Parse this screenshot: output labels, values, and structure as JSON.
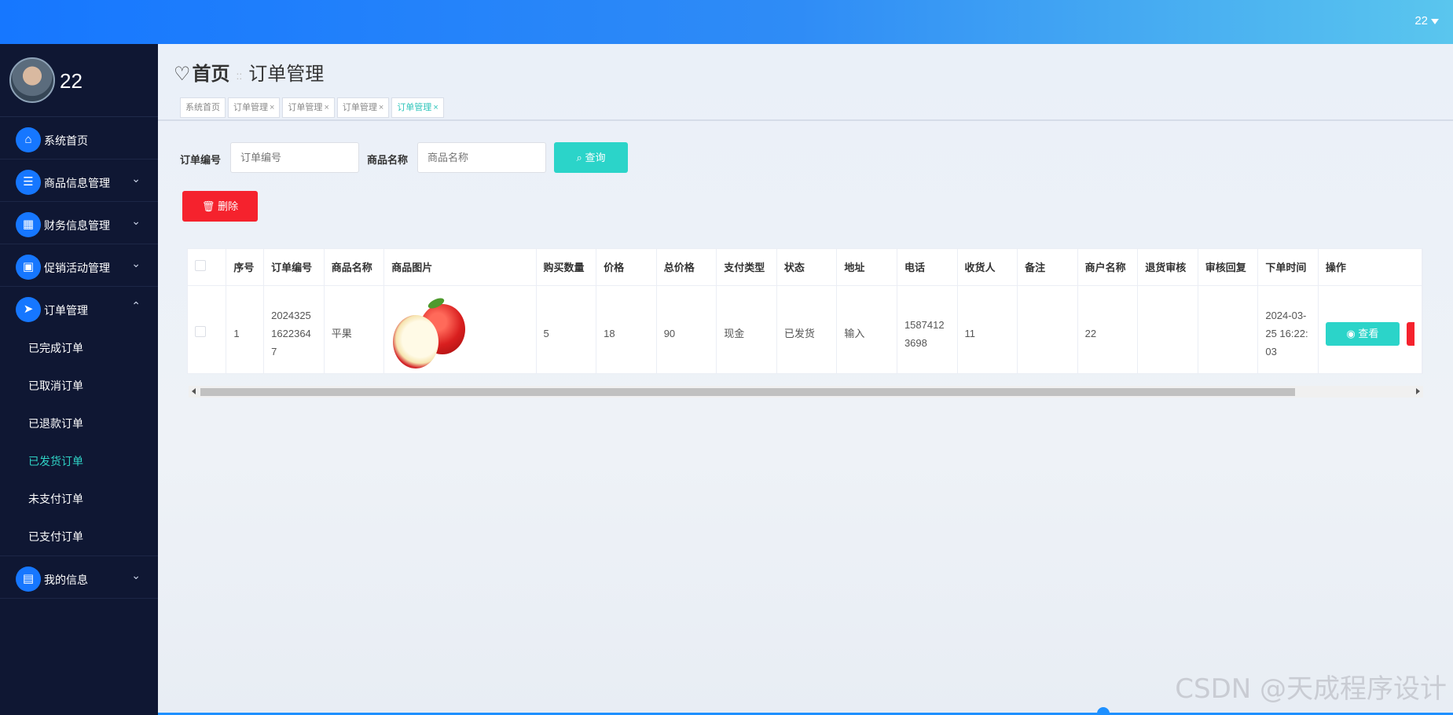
{
  "topbar": {
    "user": "22"
  },
  "sidebar": {
    "username": "22",
    "items": [
      {
        "label": "系统首页",
        "icon": "home-icon",
        "glyph": "⌂",
        "expandable": false
      },
      {
        "label": "商品信息管理",
        "icon": "list-icon",
        "glyph": "☰",
        "expandable": true
      },
      {
        "label": "财务信息管理",
        "icon": "grid-icon",
        "glyph": "▦",
        "expandable": true
      },
      {
        "label": "促销活动管理",
        "icon": "apps-icon",
        "glyph": "▣",
        "expandable": true
      },
      {
        "label": "订单管理",
        "icon": "send-icon",
        "glyph": "➤",
        "expandable": true,
        "expanded": true
      },
      {
        "label": "我的信息",
        "icon": "card-icon",
        "glyph": "▤",
        "expandable": true
      }
    ],
    "submenu": [
      {
        "label": "已完成订单",
        "active": false
      },
      {
        "label": "已取消订单",
        "active": false
      },
      {
        "label": "已退款订单",
        "active": false
      },
      {
        "label": "已发货订单",
        "active": true
      },
      {
        "label": "未支付订单",
        "active": false
      },
      {
        "label": "已支付订单",
        "active": false
      }
    ]
  },
  "breadcrumb": {
    "home": "首页",
    "separator": "::",
    "current": "订单管理"
  },
  "tabs": [
    {
      "label": "系统首页",
      "closable": false,
      "active": false
    },
    {
      "label": "订单管理",
      "closable": true,
      "active": false
    },
    {
      "label": "订单管理",
      "closable": true,
      "active": false
    },
    {
      "label": "订单管理",
      "closable": true,
      "active": false
    },
    {
      "label": "订单管理",
      "closable": true,
      "active": true
    }
  ],
  "search": {
    "order_no_label": "订单编号",
    "order_no_placeholder": "订单编号",
    "product_label": "商品名称",
    "product_placeholder": "商品名称",
    "query_button": "查询",
    "delete_button": "删除"
  },
  "table": {
    "headers": [
      "序号",
      "订单编号",
      "商品名称",
      "商品图片",
      "购买数量",
      "价格",
      "总价格",
      "支付类型",
      "状态",
      "地址",
      "电话",
      "收货人",
      "备注",
      "商户名称",
      "退货审核",
      "审核回复",
      "下单时间",
      "操作"
    ],
    "rows": [
      {
        "index": "1",
        "order_no": "20243251622364 7",
        "product": "平果",
        "quantity": "5",
        "price": "18",
        "total": "90",
        "pay_type": "现金",
        "status": "已发货",
        "address": "输入",
        "phone": "15874123698",
        "receiver": "11",
        "remark": "",
        "merchant": "22",
        "return_review": "",
        "review_reply": "",
        "order_time": "2024-03-25 16:22:03",
        "view_button": "查看"
      }
    ]
  },
  "watermark": "CSDN @天成程序设计"
}
